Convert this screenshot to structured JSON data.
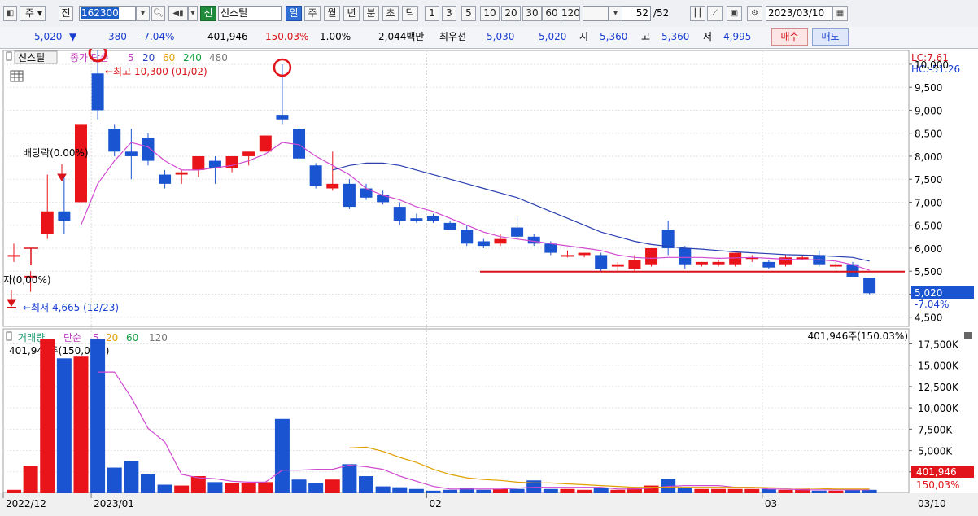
{
  "toolbar": {
    "market": "주",
    "prefix": "전",
    "code": "162300",
    "name_tag": "신",
    "name": "신스틸",
    "periods": [
      "일",
      "주",
      "월",
      "년",
      "분",
      "초",
      "틱"
    ],
    "numbers": [
      "1",
      "3",
      "5",
      "10",
      "20",
      "30",
      "60",
      "120"
    ],
    "count": "52",
    "total": "/52",
    "date": "2023/03/10"
  },
  "quote": {
    "price": "5,020",
    "arrow": "▼",
    "change": "380",
    "change_pct": "-7.04%",
    "volume": "401,946",
    "volume_ratio": "150.03%",
    "turnover_pct": "1.00%",
    "amount": "2,044백만",
    "best_ask_label": "최우선",
    "best_ask": "5,030",
    "best_bid": "5,020",
    "open_label": "시",
    "open": "5,360",
    "high_label": "고",
    "high": "5,360",
    "low_label": "저",
    "low": "4,995",
    "buy": "매수",
    "sell": "매도"
  },
  "chart_data": [
    {
      "type": "candlestick",
      "name": "신스틸",
      "legend_main": "종가 단순",
      "ma_periods": [
        "5",
        "20",
        "60",
        "240",
        "480"
      ],
      "lc": "LC:7.61",
      "hc": "HC:-51.26",
      "y_ticks": [
        "10,000",
        "9,500",
        "9,000",
        "8,500",
        "8,000",
        "7,500",
        "7,000",
        "6,500",
        "6,000",
        "5,500",
        "5,000",
        "4,500"
      ],
      "ylim": [
        4300,
        10300
      ],
      "current_label": "5,020",
      "current_pct": "-7.04%",
      "support_line": 5490,
      "annot_high": "←최고 10,300 (01/02)",
      "annot_low": "←최저 4,665 (12/23)",
      "annot_div": "배당락(0.00%)",
      "annot_cap": "자(0,00%)",
      "candles": [
        {
          "o": 5850,
          "h": 6100,
          "l": 5700,
          "c": 5850
        },
        {
          "o": 5400,
          "h": 5500,
          "l": 5050,
          "c": 5400
        },
        {
          "o": 6300,
          "h": 7600,
          "l": 6200,
          "c": 6800
        },
        {
          "o": 6800,
          "h": 7600,
          "l": 6300,
          "c": 6600
        },
        {
          "o": 7000,
          "h": 8700,
          "l": 6800,
          "c": 8700
        },
        {
          "o": 9800,
          "h": 10300,
          "l": 8800,
          "c": 9000
        },
        {
          "o": 8600,
          "h": 8700,
          "l": 8000,
          "c": 8100
        },
        {
          "o": 8100,
          "h": 8600,
          "l": 7500,
          "c": 8000
        },
        {
          "o": 8400,
          "h": 8500,
          "l": 7800,
          "c": 7900
        },
        {
          "o": 7600,
          "h": 7700,
          "l": 7300,
          "c": 7400
        },
        {
          "o": 7600,
          "h": 7700,
          "l": 7400,
          "c": 7650
        },
        {
          "o": 7700,
          "h": 7900,
          "l": 7550,
          "c": 8000
        },
        {
          "o": 7900,
          "h": 8000,
          "l": 7400,
          "c": 7750
        },
        {
          "o": 7750,
          "h": 8000,
          "l": 7650,
          "c": 8000
        },
        {
          "o": 8000,
          "h": 8100,
          "l": 7800,
          "c": 8100
        },
        {
          "o": 8100,
          "h": 8300,
          "l": 8100,
          "c": 8450
        },
        {
          "o": 8900,
          "h": 10000,
          "l": 8700,
          "c": 8800
        },
        {
          "o": 8600,
          "h": 8650,
          "l": 7900,
          "c": 7950
        },
        {
          "o": 7800,
          "h": 7850,
          "l": 7300,
          "c": 7350
        },
        {
          "o": 7300,
          "h": 8100,
          "l": 7250,
          "c": 7400
        },
        {
          "o": 7400,
          "h": 7500,
          "l": 6850,
          "c": 6900
        },
        {
          "o": 7300,
          "h": 7400,
          "l": 7050,
          "c": 7100
        },
        {
          "o": 7150,
          "h": 7250,
          "l": 6950,
          "c": 7000
        },
        {
          "o": 6900,
          "h": 7000,
          "l": 6500,
          "c": 6600
        },
        {
          "o": 6650,
          "h": 6750,
          "l": 6550,
          "c": 6600
        },
        {
          "o": 6700,
          "h": 6750,
          "l": 6550,
          "c": 6600
        },
        {
          "o": 6550,
          "h": 6600,
          "l": 6400,
          "c": 6400
        },
        {
          "o": 6400,
          "h": 6500,
          "l": 6050,
          "c": 6100
        },
        {
          "o": 6150,
          "h": 6200,
          "l": 6000,
          "c": 6050
        },
        {
          "o": 6100,
          "h": 6300,
          "l": 6050,
          "c": 6200
        },
        {
          "o": 6450,
          "h": 6700,
          "l": 6200,
          "c": 6250
        },
        {
          "o": 6250,
          "h": 6300,
          "l": 6050,
          "c": 6100
        },
        {
          "o": 6100,
          "h": 6150,
          "l": 5850,
          "c": 5900
        },
        {
          "o": 5850,
          "h": 5950,
          "l": 5800,
          "c": 5850
        },
        {
          "o": 5850,
          "h": 5900,
          "l": 5800,
          "c": 5900
        },
        {
          "o": 5850,
          "h": 5900,
          "l": 5500,
          "c": 5550
        },
        {
          "o": 5600,
          "h": 5700,
          "l": 5450,
          "c": 5650
        },
        {
          "o": 5550,
          "h": 5850,
          "l": 5500,
          "c": 5750
        },
        {
          "o": 5650,
          "h": 5950,
          "l": 5600,
          "c": 6000
        },
        {
          "o": 6400,
          "h": 6600,
          "l": 5850,
          "c": 6000
        },
        {
          "o": 6000,
          "h": 6050,
          "l": 5550,
          "c": 5650
        },
        {
          "o": 5650,
          "h": 5700,
          "l": 5600,
          "c": 5700
        },
        {
          "o": 5650,
          "h": 5750,
          "l": 5600,
          "c": 5700
        },
        {
          "o": 5650,
          "h": 5900,
          "l": 5600,
          "c": 5900
        },
        {
          "o": 5800,
          "h": 5850,
          "l": 5700,
          "c": 5800
        },
        {
          "o": 5700,
          "h": 5750,
          "l": 5550,
          "c": 5580
        },
        {
          "o": 5650,
          "h": 5850,
          "l": 5600,
          "c": 5800
        },
        {
          "o": 5800,
          "h": 5850,
          "l": 5750,
          "c": 5800
        },
        {
          "o": 5850,
          "h": 5950,
          "l": 5600,
          "c": 5650
        },
        {
          "o": 5600,
          "h": 5700,
          "l": 5550,
          "c": 5650
        },
        {
          "o": 5650,
          "h": 5700,
          "l": 5500,
          "c": 5380
        },
        {
          "o": 5360,
          "h": 5360,
          "l": 4995,
          "c": 5020
        }
      ],
      "ma5": [
        null,
        null,
        null,
        null,
        6500,
        7400,
        7900,
        8300,
        8200,
        7900,
        7700,
        7700,
        7750,
        7800,
        7900,
        8050,
        8300,
        8250,
        8000,
        7800,
        7600,
        7300,
        7150,
        7050,
        6900,
        6800,
        6650,
        6500,
        6350,
        6250,
        6200,
        6150,
        6100,
        6050,
        6000,
        5950,
        5850,
        5800,
        5780,
        5800,
        5800,
        5800,
        5780,
        5790,
        5800,
        5780,
        5760,
        5750,
        5750,
        5720,
        5640,
        5520
      ],
      "ma20": [
        null,
        null,
        null,
        null,
        null,
        null,
        null,
        null,
        null,
        null,
        null,
        null,
        null,
        null,
        null,
        null,
        null,
        null,
        null,
        7700,
        7800,
        7850,
        7850,
        7800,
        7700,
        7600,
        7500,
        7400,
        7300,
        7200,
        7100,
        6950,
        6800,
        6650,
        6500,
        6350,
        6250,
        6150,
        6080,
        6040,
        6000,
        5980,
        5950,
        5920,
        5900,
        5880,
        5860,
        5850,
        5840,
        5820,
        5800,
        5720
      ]
    },
    {
      "type": "bar",
      "name": "거래량",
      "legend_main": "단순",
      "ma_periods": [
        "5",
        "20",
        "60",
        "120"
      ],
      "top_label": "401,946주(150.03%)",
      "top_label_left": "401,946주(150,03%)",
      "y_ticks": [
        "17,500K",
        "15,000K",
        "12,500K",
        "10,000K",
        "7,500K",
        "5,000K",
        "2,500K"
      ],
      "ylim": [
        0,
        18500
      ],
      "current_label": "401,946",
      "current_pct": "150,03%",
      "values": [
        400,
        3200,
        18100,
        15800,
        16000,
        18100,
        3000,
        3800,
        2200,
        1000,
        900,
        2000,
        1300,
        1200,
        1200,
        1300,
        8700,
        1600,
        1200,
        1600,
        3400,
        2000,
        800,
        700,
        500,
        300,
        400,
        600,
        400,
        500,
        500,
        1500,
        500,
        500,
        400,
        600,
        400,
        600,
        900,
        1700,
        700,
        500,
        500,
        500,
        500,
        500,
        400,
        500,
        300,
        300,
        400,
        400
      ],
      "ma5": [
        null,
        null,
        null,
        null,
        null,
        14200,
        14200,
        11200,
        7600,
        6000,
        2200,
        1800,
        1700,
        1400,
        1300,
        1300,
        2700,
        2700,
        2800,
        2800,
        3300,
        3100,
        2800,
        2000,
        1400,
        800,
        500,
        500,
        500,
        500,
        600,
        700,
        700,
        700,
        700,
        700,
        500,
        500,
        600,
        800,
        900,
        900,
        900,
        700,
        700,
        500,
        500,
        400,
        400,
        400,
        400,
        400
      ],
      "ma20": [
        null,
        null,
        null,
        null,
        null,
        null,
        null,
        null,
        null,
        null,
        null,
        null,
        null,
        null,
        null,
        null,
        null,
        null,
        null,
        null,
        5300,
        5400,
        4900,
        4200,
        3600,
        2800,
        2200,
        1800,
        1600,
        1500,
        1300,
        1200,
        1200,
        1100,
        1000,
        900,
        800,
        700,
        700,
        700,
        700,
        700,
        700,
        700,
        700,
        650,
        600,
        600,
        550,
        500,
        500,
        500
      ]
    }
  ],
  "x_axis": {
    "labels": [
      "2022/12",
      "2023/01",
      "02",
      "03"
    ],
    "right_label": "03/10"
  }
}
